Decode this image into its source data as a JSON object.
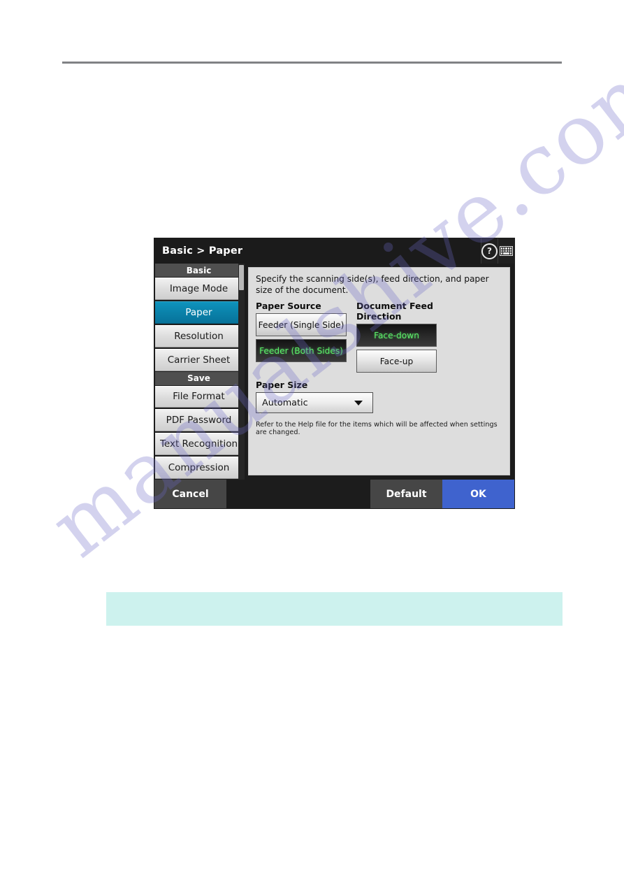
{
  "dialog": {
    "titlebar": {
      "breadcrumb": "Basic > Paper",
      "help_icon": "help-question-icon",
      "keyboard_icon": "keyboard-icon"
    },
    "sidebar": {
      "groups": [
        {
          "header": "Basic",
          "items": [
            {
              "label": "Image Mode",
              "selected": false
            },
            {
              "label": "Paper",
              "selected": true
            },
            {
              "label": "Resolution",
              "selected": false
            },
            {
              "label": "Carrier Sheet",
              "selected": false
            }
          ]
        },
        {
          "header": "Save",
          "items": [
            {
              "label": "File Format",
              "selected": false
            },
            {
              "label": "PDF Password",
              "selected": false
            },
            {
              "label": "Text Recognition",
              "selected": false
            },
            {
              "label": "Compression",
              "selected": false
            }
          ]
        }
      ]
    },
    "panel": {
      "description": "Specify the scanning side(s), feed direction, and paper size of the document.",
      "paper_source": {
        "label": "Paper Source",
        "options": [
          {
            "label": "Feeder (Single Side)",
            "selected": false
          },
          {
            "label": "Feeder (Both Sides)",
            "selected": true
          }
        ]
      },
      "feed_direction": {
        "label": "Document Feed Direction",
        "options": [
          {
            "label": "Face-down",
            "selected": true
          },
          {
            "label": "Face-up",
            "selected": false
          }
        ]
      },
      "paper_size": {
        "label": "Paper Size",
        "value": "Automatic",
        "caret_icon": "chevron-down-icon"
      },
      "note": "Refer to the Help file for the items which will be affected when settings are changed."
    },
    "footer": {
      "cancel": "Cancel",
      "default": "Default",
      "ok": "OK"
    }
  },
  "page": {
    "watermark": "manualshive.com"
  },
  "colors": {
    "accent_selected": "#0a80a8",
    "ok_button": "#3f63ce",
    "selected_option_text": "#5cf06a",
    "teal_band": "#cdf2ee",
    "rule": "#808285"
  }
}
